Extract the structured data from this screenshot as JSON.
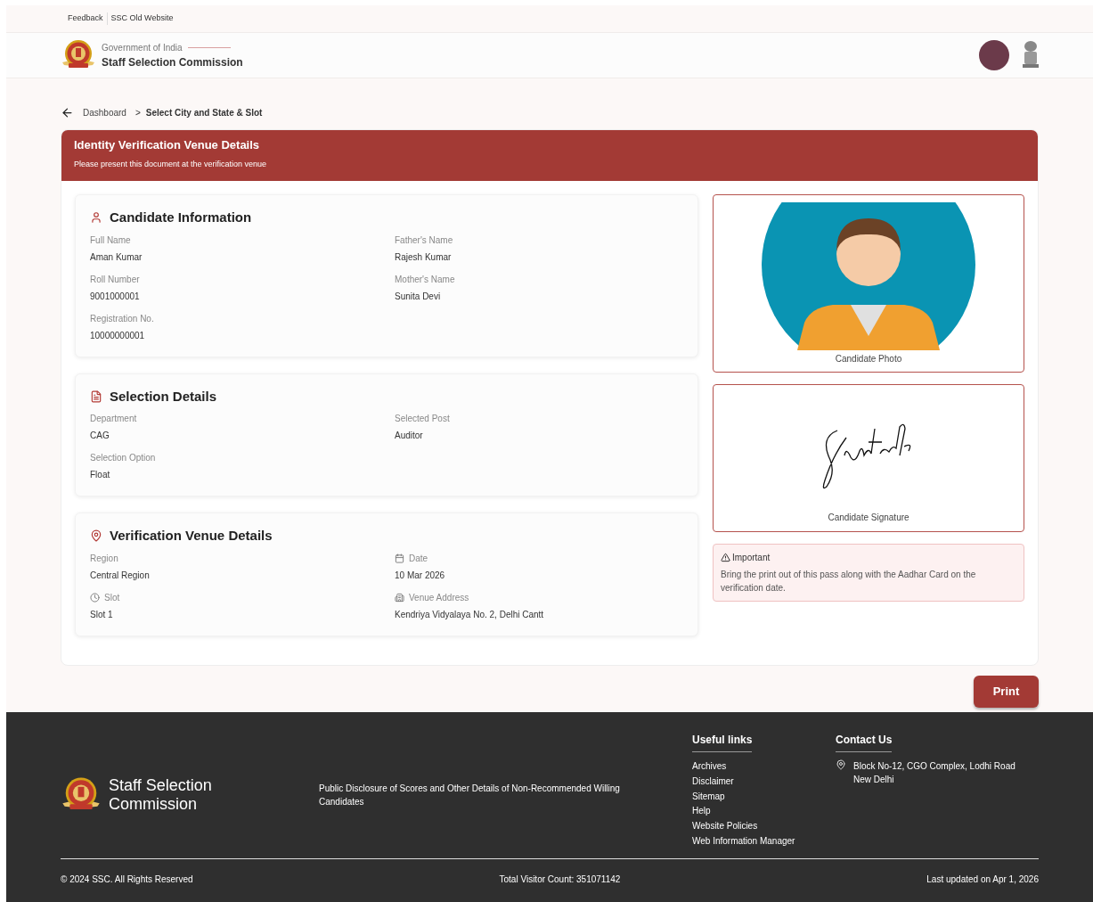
{
  "top_links": [
    "Feedback",
    "SSC Old Website"
  ],
  "header": {
    "subtitle": "Government of India",
    "title": "Staff Selection Commission"
  },
  "breadcrumb": {
    "back": "Dashboard",
    "separator": ">",
    "current": "Select City and State & Slot"
  },
  "banner": {
    "title": "Identity Verification Venue Details",
    "subtitle": "Please present this document at the verification venue"
  },
  "sections": [
    {
      "title": "Candidate Information",
      "fields": [
        {
          "label": "Full Name",
          "value": "Aman Kumar"
        },
        {
          "label": "Father's Name",
          "value": "Rajesh Kumar"
        },
        {
          "label": "Roll Number",
          "value": "9001000001"
        },
        {
          "label": "Mother's Name",
          "value": "Sunita Devi"
        },
        {
          "label": "Registration No.",
          "value": "10000000001"
        }
      ]
    },
    {
      "title": "Selection Details",
      "fields": [
        {
          "label": "Department",
          "value": "CAG"
        },
        {
          "label": "Selected Post",
          "value": "Auditor"
        },
        {
          "label": "Selection Option",
          "value": "Float"
        }
      ]
    },
    {
      "title": "Verification Venue Details",
      "fields": [
        {
          "label": "Region",
          "value": "Central Region"
        },
        {
          "label": "Date",
          "value": "10 Mar 2026"
        },
        {
          "label": "Slot",
          "value": "Slot 1"
        },
        {
          "label": "Venue Address",
          "value": "Kendriya Vidyalaya No. 2, Delhi Cantt"
        }
      ]
    }
  ],
  "photo_caption": "Candidate Photo",
  "signature_caption": "Candidate Signature",
  "notice": {
    "title": "Important",
    "text": "Bring the print out of this pass along with the Aadhar Card on the verification date."
  },
  "print_button": "Print",
  "footer": {
    "brand": "Staff Selection Commission",
    "disclosure": "Public Disclosure of Scores and Other Details of Non-Recommended Willing Candidates",
    "useful_links_title": "Useful links",
    "useful_links": [
      "Archives",
      "Disclaimer",
      "Sitemap",
      "Help",
      "Website Policies",
      "Web Information Manager"
    ],
    "contact_title": "Contact Us",
    "address_lines": [
      "Block No-12, CGO Complex, Lodhi Road",
      "New Delhi"
    ],
    "copyright": "© 2024 SSC. All Rights Reserved",
    "visitor_count": "Total Visitor Count: 351071142",
    "last_updated": "Last updated on Apr 1, 2026"
  }
}
